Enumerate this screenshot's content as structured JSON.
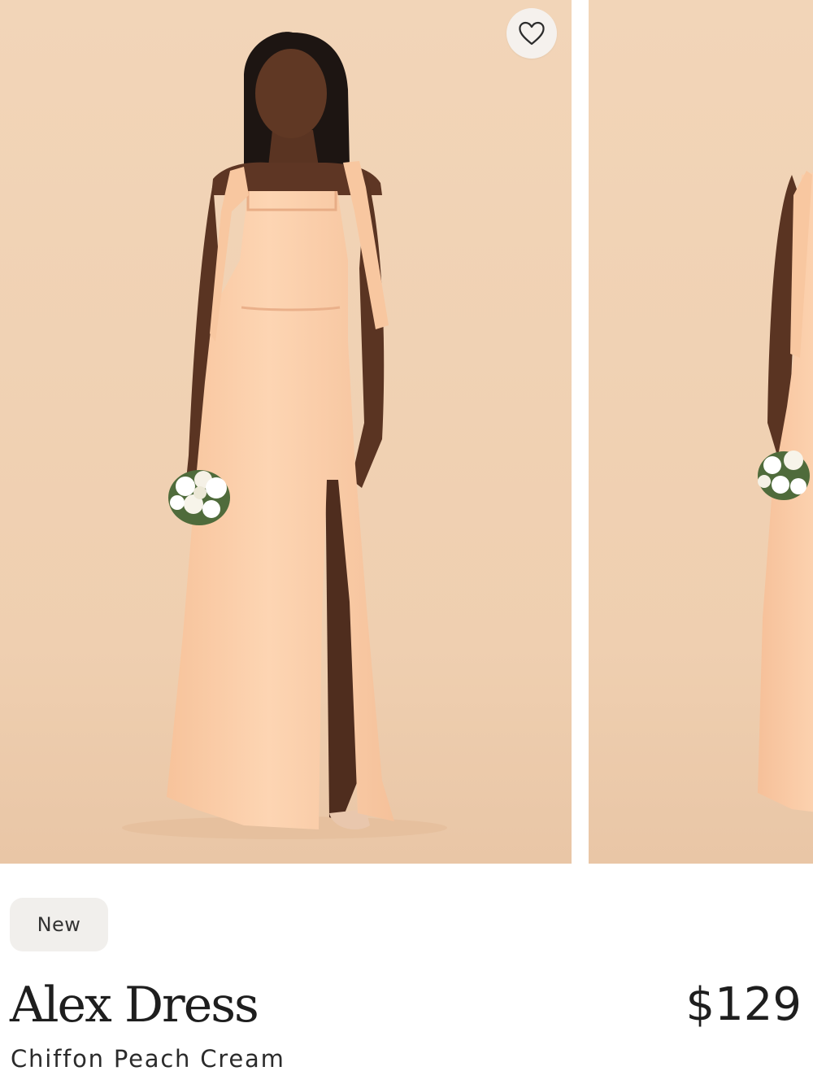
{
  "product": {
    "badge": "New",
    "name": "Alex Dress",
    "variant": "Chiffon Peach Cream",
    "price": "$129"
  },
  "icons": {
    "favorite": "heart-outline-icon"
  },
  "colors": {
    "backdrop": "#f1d3b5",
    "dress": "#fccfaa",
    "badge_bg": "#f1efec",
    "text": "#1e1e1e"
  }
}
